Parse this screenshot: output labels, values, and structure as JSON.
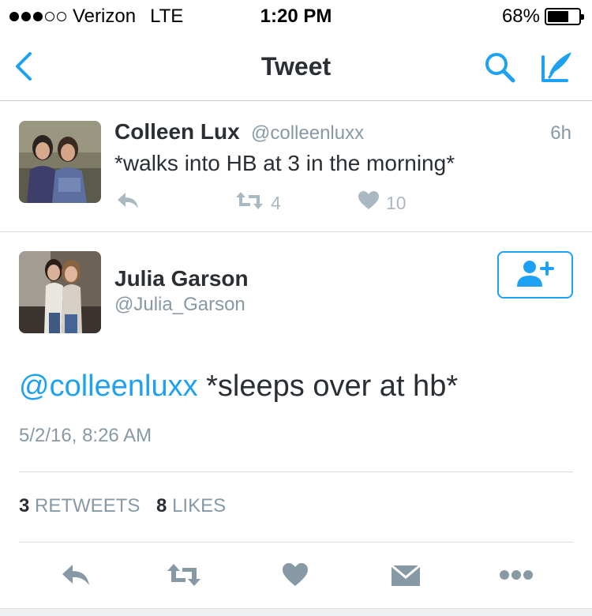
{
  "status_bar": {
    "carrier": "Verizon",
    "network": "LTE",
    "time": "1:20 PM",
    "battery": "68%",
    "battery_level": 0.68,
    "signal_bars": 3,
    "signal_total": 5
  },
  "nav": {
    "title": "Tweet",
    "back_icon": "chevron-left-icon",
    "search_icon": "search-icon",
    "compose_icon": "compose-icon",
    "accent": "#1da1f2"
  },
  "parent_tweet": {
    "name": "Colleen Lux",
    "handle": "@colleenluxx",
    "time": "6h",
    "text": "*walks into HB at 3 in the morning*",
    "retweets": "4",
    "likes": "10"
  },
  "main_tweet": {
    "name": "Julia Garson",
    "handle": "@Julia_Garson",
    "mention": "@colleenluxx",
    "text": " *sleeps over at hb*",
    "date": "5/2/16, 8:26 AM",
    "retweet_count": "3",
    "retweet_label": "RETWEETS",
    "like_count": "8",
    "like_label": "LIKES"
  },
  "colors": {
    "text": "#292f33",
    "muted": "#8899a6",
    "icon_gray": "#aab8c2",
    "action_gray": "#8899a6"
  }
}
